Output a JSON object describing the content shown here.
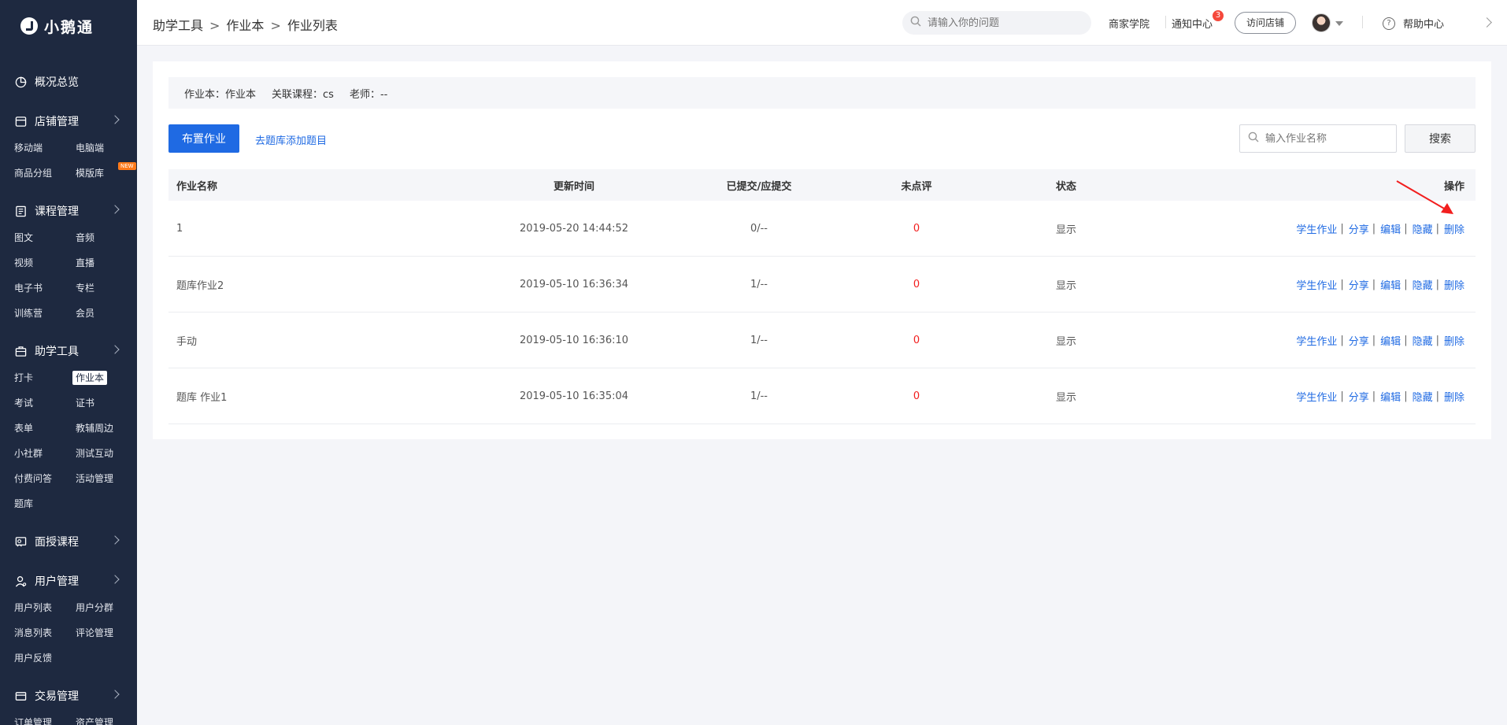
{
  "brand": {
    "name": "小鹅通"
  },
  "sidebar": {
    "overview": "概况总览",
    "sections": [
      {
        "title": "店铺管理",
        "icon": "store-icon",
        "items": [
          {
            "label": "移动端"
          },
          {
            "label": "电脑端"
          },
          {
            "label": "商品分组"
          },
          {
            "label": "模版库",
            "badge": "NEW"
          }
        ]
      },
      {
        "title": "课程管理",
        "icon": "course-icon",
        "items": [
          {
            "label": "图文"
          },
          {
            "label": "音频"
          },
          {
            "label": "视频"
          },
          {
            "label": "直播"
          },
          {
            "label": "电子书"
          },
          {
            "label": "专栏"
          },
          {
            "label": "训练营"
          },
          {
            "label": "会员"
          }
        ]
      },
      {
        "title": "助学工具",
        "icon": "toolbox-icon",
        "items": [
          {
            "label": "打卡"
          },
          {
            "label": "作业本",
            "active": true
          },
          {
            "label": "考试"
          },
          {
            "label": "证书"
          },
          {
            "label": "表单"
          },
          {
            "label": "教辅周边"
          },
          {
            "label": "小社群"
          },
          {
            "label": "测试互动"
          },
          {
            "label": "付费问答"
          },
          {
            "label": "活动管理"
          },
          {
            "label": "题库"
          }
        ]
      },
      {
        "title": "面授课程",
        "icon": "classroom-icon",
        "items": []
      },
      {
        "title": "用户管理",
        "icon": "user-icon",
        "items": [
          {
            "label": "用户列表"
          },
          {
            "label": "用户分群"
          },
          {
            "label": "消息列表"
          },
          {
            "label": "评论管理"
          },
          {
            "label": "用户反馈"
          }
        ]
      },
      {
        "title": "交易管理",
        "icon": "trade-icon",
        "items": [
          {
            "label": "订单管理"
          },
          {
            "label": "资产管理"
          }
        ]
      }
    ]
  },
  "header": {
    "breadcrumb": [
      "助学工具",
      "作业本",
      "作业列表"
    ],
    "breadcrumb_sep": ">",
    "search_placeholder": "请输入你的问题",
    "merchant_academy": "商家学院",
    "notify": "通知中心",
    "notify_count": "3",
    "visit_store": "访问店铺",
    "help": "帮助中心"
  },
  "info": {
    "book": "作业本：作业本",
    "course": "关联课程：cs",
    "teacher": "老师：--"
  },
  "toolbar": {
    "assign": "布置作业",
    "bank_link": "去题库添加题目",
    "search_placeholder": "输入作业名称",
    "search_button": "搜索"
  },
  "table": {
    "headers": {
      "name": "作业名称",
      "time": "更新时间",
      "submitted": "已提交/应提交",
      "unreviewed": "未点评",
      "status": "状态",
      "ops": "操作"
    },
    "ops": [
      "学生作业",
      "分享",
      "编辑",
      "隐藏",
      "删除"
    ],
    "op_sep": "|",
    "rows": [
      {
        "name": "1",
        "time": "2019-05-20 14:44:52",
        "submitted": "0/--",
        "unreviewed": "0",
        "status": "显示"
      },
      {
        "name": "题库作业2",
        "time": "2019-05-10 16:36:34",
        "submitted": "1/--",
        "unreviewed": "0",
        "status": "显示"
      },
      {
        "name": "手动",
        "time": "2019-05-10 16:36:10",
        "submitted": "1/--",
        "unreviewed": "0",
        "status": "显示"
      },
      {
        "name": "题库 作业1",
        "time": "2019-05-10 16:35:04",
        "submitted": "1/--",
        "unreviewed": "0",
        "status": "显示"
      }
    ]
  },
  "colors": {
    "sidebar_bg": "#1e2940",
    "primary": "#1f6ae3",
    "danger": "#f21e1e",
    "annotation_arrow": "#f21e1e"
  }
}
